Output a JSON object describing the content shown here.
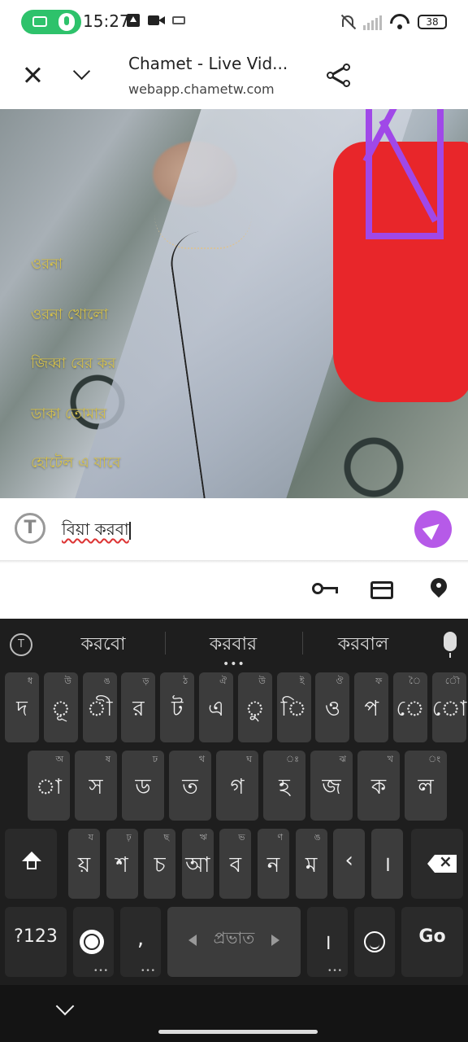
{
  "status_bar": {
    "time": "15:27",
    "battery": "38"
  },
  "browser": {
    "title": "Chamet - Live Vid...",
    "url": "webapp.chametw.com"
  },
  "chat_messages": [
    "ওরনা",
    "ওরনা খোলো",
    "জিব্বা বের কর",
    "ডাকা তোমার",
    "হোটেল এ যাবে"
  ],
  "message_input": {
    "value": "বিয়া করবা"
  },
  "keyboard": {
    "suggestions": [
      "করবো",
      "করবার",
      "করবাল"
    ],
    "row1": [
      {
        "main": "দ",
        "hint": "ধ"
      },
      {
        "main": "ূ",
        "hint": "উ"
      },
      {
        "main": "ী",
        "hint": "ঙ"
      },
      {
        "main": "র",
        "hint": "ড়"
      },
      {
        "main": "ট",
        "hint": "ঠ"
      },
      {
        "main": "এ",
        "hint": "ঐ"
      },
      {
        "main": "ু",
        "hint": "উ"
      },
      {
        "main": "ি",
        "hint": "ই"
      },
      {
        "main": "ও",
        "hint": "ঔ"
      },
      {
        "main": "প",
        "hint": "ফ"
      },
      {
        "main": "ে",
        "hint": "ৈ"
      },
      {
        "main": "ো",
        "hint": "ৌ"
      }
    ],
    "row2": [
      {
        "main": "া",
        "hint": "অ"
      },
      {
        "main": "স",
        "hint": "ষ"
      },
      {
        "main": "ড",
        "hint": "ঢ"
      },
      {
        "main": "ত",
        "hint": "থ"
      },
      {
        "main": "গ",
        "hint": "ঘ"
      },
      {
        "main": "হ",
        "hint": "ঃ"
      },
      {
        "main": "জ",
        "hint": "ঝ"
      },
      {
        "main": "ক",
        "hint": "খ"
      },
      {
        "main": "ল",
        "hint": "ং"
      }
    ],
    "row3": [
      {
        "main": "য়",
        "hint": "য"
      },
      {
        "main": "শ",
        "hint": "ঢ়"
      },
      {
        "main": "চ",
        "hint": "ছ"
      },
      {
        "main": "আ",
        "hint": "ঋ"
      },
      {
        "main": "ব",
        "hint": "ভ"
      },
      {
        "main": "ন",
        "hint": "ণ"
      },
      {
        "main": "ম",
        "hint": "ঙ"
      },
      {
        "main": "‹",
        "hint": ""
      },
      {
        "main": "।",
        "hint": ""
      }
    ],
    "symbols_label": "?123",
    "comma": ",",
    "space_label": "প্রভাত",
    "period": "।",
    "go_label": "Go"
  }
}
